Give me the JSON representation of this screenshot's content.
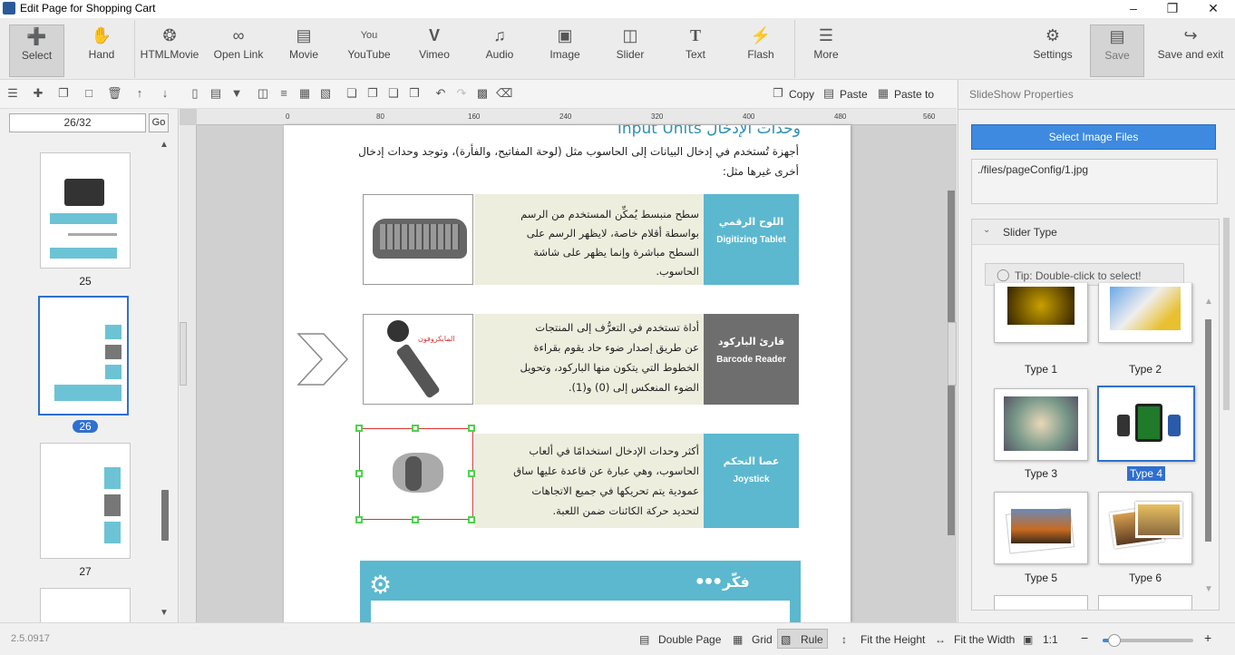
{
  "window": {
    "title": "Edit Page for Shopping Cart"
  },
  "toolbar": {
    "items": [
      "Select",
      "Hand",
      "HTMLMovie",
      "Open Link",
      "Movie",
      "YouTube",
      "Vimeo",
      "Audio",
      "Image",
      "Slider",
      "Text",
      "Flash",
      "More"
    ],
    "right": [
      "Settings",
      "Save",
      "Save and exit"
    ]
  },
  "subbar": {
    "copy": "Copy",
    "paste": "Paste",
    "paste_to": "Paste to"
  },
  "pages": {
    "current": "26/32",
    "go": "Go",
    "thumbs": [
      "25",
      "26",
      "27"
    ]
  },
  "ruler": {
    "h": [
      "0",
      "80",
      "160",
      "240",
      "320",
      "400",
      "480",
      "560"
    ]
  },
  "content": {
    "heading": "وحدات الإدخال Input Units",
    "intro1": "أجهزة تُستخدم في إدخال البيانات إلى الحاسوب مثل (لوحة المفاتيح، والفأرة)، وتوجد وحدات إدخال",
    "intro2": "أخرى غيرها مثل:",
    "rows": [
      {
        "ar_title": "اللوح الرقمي",
        "en_title": "Digitizing Tablet",
        "lines": [
          "سطح منبسط يُمكِّن المستخدم من الرسم",
          "بواسطة أقلام خاصة، لايظهر الرسم على",
          "السطح مباشرة وإنما يظهر على شاشة",
          "الحاسوب."
        ]
      },
      {
        "ar_title": "قارئ الباركود",
        "en_title": "Barcode Reader",
        "lines": [
          "أداة تستخدم في التعرُّف إلى المنتجات",
          "عن طريق إصدار ضوء حاد يقوم بقراءة",
          "الخطوط التي يتكون منها الباركود، وتحويل",
          "الضوء المنعكس إلى (0) و(1)."
        ]
      },
      {
        "ar_title": "عصا التحكم",
        "en_title": "Joystick",
        "lines": [
          "أكثر وحدات الإدخال استخدامًا في ألعاب",
          "الحاسوب، وهي عبارة عن قاعدة عليها ساق",
          "عمودية يتم تحريكها في جميع الاتجاهات",
          "لتحديد حركة الكائنات ضمن اللعبة."
        ]
      }
    ],
    "mic_label": "المايكروفون",
    "think": "فكّر"
  },
  "props": {
    "title": "SlideShow Properties",
    "select_files": "Select Image Files",
    "path": "./files/pageConfig/1.jpg",
    "slider_type": "Slider Type",
    "tip": "Tip: Double-click to select!",
    "types": [
      "Type 1",
      "Type 2",
      "Type 3",
      "Type 4",
      "Type 5",
      "Type 6"
    ],
    "selected_type": "Type 4"
  },
  "status": {
    "version": "2.5.0917",
    "double_page": "Double Page",
    "grid": "Grid",
    "rule": "Rule",
    "fit_height": "Fit the Height",
    "fit_width": "Fit the Width",
    "one_to_one": "1:1",
    "zoom": 0.08
  },
  "colors": {
    "teal": "#5bb8cf",
    "gray_label": "#6e6e6e",
    "accent": "#3d8ae0",
    "selection": "#2f6fd0"
  }
}
